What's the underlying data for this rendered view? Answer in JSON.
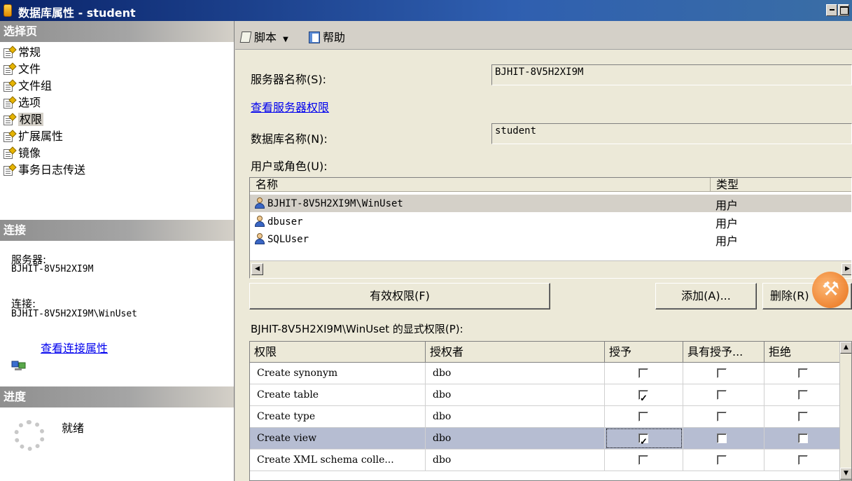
{
  "window": {
    "title": "数据库属性 - student",
    "accent_color": "#0a246a"
  },
  "left": {
    "select_page_header": "选择页",
    "pages": [
      {
        "label": "常规",
        "icon": "property-page-icon"
      },
      {
        "label": "文件",
        "icon": "property-page-icon"
      },
      {
        "label": "文件组",
        "icon": "property-page-icon"
      },
      {
        "label": "选项",
        "icon": "property-page-icon"
      },
      {
        "label": "权限",
        "icon": "property-page-icon",
        "selected": true
      },
      {
        "label": "扩展属性",
        "icon": "property-page-icon"
      },
      {
        "label": "镜像",
        "icon": "property-page-icon"
      },
      {
        "label": "事务日志传送",
        "icon": "property-page-icon"
      }
    ],
    "connection_header": "连接",
    "server_label": "服务器:",
    "server_value": "BJHIT-8V5H2XI9M",
    "connection_label": "连接:",
    "connection_value": "BJHIT-8V5H2XI9M\\WinUset",
    "view_connection_props": "查看连接属性",
    "progress_header": "进度",
    "progress_status": "就绪"
  },
  "toolbar": {
    "script_label": "脚本",
    "help_label": "帮助"
  },
  "main": {
    "server_name_label": "服务器名称(S):",
    "server_name_value": "BJHIT-8V5H2XI9M",
    "view_server_perms": "查看服务器权限",
    "db_name_label": "数据库名称(N):",
    "db_name_value": "student",
    "users_label": "用户或角色(U):",
    "users_columns": [
      "名称",
      "类型"
    ],
    "users": [
      {
        "name": "BJHIT-8V5H2XI9M\\WinUset",
        "type": "用户",
        "selected": true
      },
      {
        "name": "dbuser",
        "type": "用户"
      },
      {
        "name": "SQLUser",
        "type": "用户"
      }
    ],
    "effective_perms_button": "有效权限(F)",
    "add_button": "添加(A)...",
    "remove_button": "删除(R)",
    "explicit_perms_label": "BJHIT-8V5H2XI9M\\WinUset 的显式权限(P):",
    "perm_columns": [
      "权限",
      "授权者",
      "授予",
      "具有授予...",
      "拒绝"
    ],
    "permissions": [
      {
        "permission": "Create synonym",
        "grantor": "dbo",
        "grant": false,
        "with_grant": false,
        "deny": false
      },
      {
        "permission": "Create table",
        "grantor": "dbo",
        "grant": true,
        "with_grant": false,
        "deny": false
      },
      {
        "permission": "Create type",
        "grantor": "dbo",
        "grant": false,
        "with_grant": false,
        "deny": false
      },
      {
        "permission": "Create view",
        "grantor": "dbo",
        "grant": true,
        "with_grant": false,
        "deny": false,
        "selected": true
      },
      {
        "permission": "Create XML schema colle...",
        "grantor": "dbo",
        "grant": false,
        "with_grant": false,
        "deny": false
      }
    ]
  }
}
